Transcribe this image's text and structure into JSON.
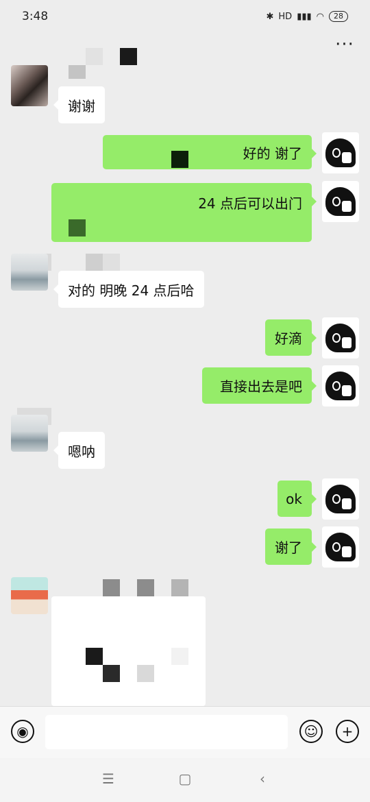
{
  "status": {
    "time": "3:48",
    "battery": "28",
    "network": "HD"
  },
  "menu": {
    "more_label": "···"
  },
  "messages": [
    {
      "side": "left",
      "text": "谢谢",
      "avatar": "photo-avatar"
    },
    {
      "side": "right",
      "text": "好的 谢了",
      "avatar": "bear-avatar"
    },
    {
      "side": "right",
      "text": "24 点后可以出门",
      "avatar": "bear-avatar"
    },
    {
      "side": "left",
      "text": "对的 明晚 24 点后哈",
      "avatar": "sea-avatar"
    },
    {
      "side": "right",
      "text": "好滴",
      "avatar": "bear-avatar"
    },
    {
      "side": "right",
      "text": "直接出去是吧",
      "avatar": "bear-avatar"
    },
    {
      "side": "left",
      "text": "嗯呐",
      "avatar": "sea-avatar"
    },
    {
      "side": "right",
      "text": "ok",
      "avatar": "bear-avatar"
    },
    {
      "side": "right",
      "text": "谢了",
      "avatar": "bear-avatar"
    }
  ],
  "input": {
    "value": "",
    "placeholder": ""
  },
  "icons": {
    "voice": "voice-icon",
    "emoji": "emoji-icon",
    "plus": "plus-icon",
    "nav_menu": "menu-icon",
    "nav_home": "home-icon",
    "nav_back": "back-icon"
  },
  "glyphs": {
    "voice": "◉",
    "emoji": "☺",
    "plus": "+",
    "menu": "☰",
    "home": "▢",
    "back": "‹"
  },
  "colors": {
    "outgoing_bubble": "#95ec69",
    "incoming_bubble": "#ffffff",
    "background": "#ededed"
  }
}
